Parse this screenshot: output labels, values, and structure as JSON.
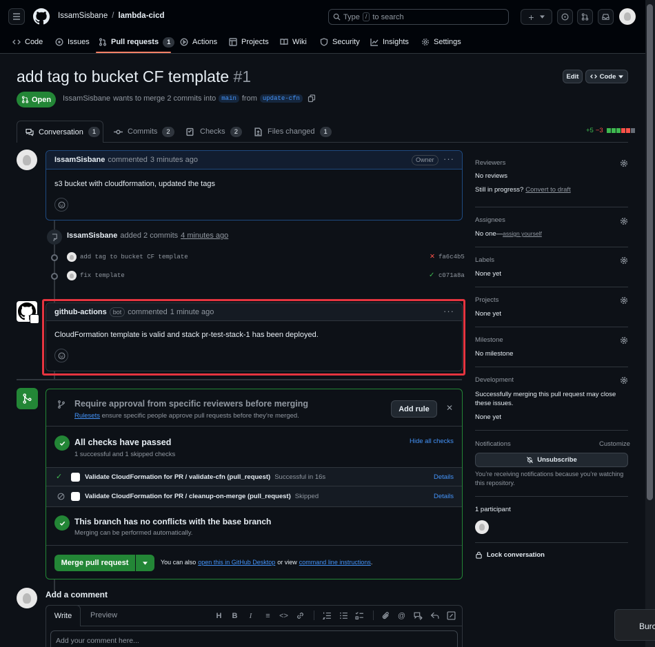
{
  "header": {
    "owner": "IssamSisbane",
    "separator": "/",
    "repo": "lambda-cicd",
    "search_placeholder_a": "Type",
    "search_key": "/",
    "search_placeholder_b": "to search",
    "new_button": "+"
  },
  "repo_tabs": [
    {
      "label": "Code"
    },
    {
      "label": "Issues"
    },
    {
      "label": "Pull requests",
      "count": "1"
    },
    {
      "label": "Actions"
    },
    {
      "label": "Projects"
    },
    {
      "label": "Wiki"
    },
    {
      "label": "Security"
    },
    {
      "label": "Insights"
    },
    {
      "label": "Settings"
    }
  ],
  "pr": {
    "title": "add tag to bucket CF template",
    "number": "#1",
    "edit_label": "Edit",
    "code_label": "Code",
    "state": "Open",
    "author": "IssamSisbane",
    "summary_mid": "wants to merge 2 commits into",
    "base_branch": "main",
    "from_word": "from",
    "head_branch": "update-cfn",
    "tabs": [
      {
        "label": "Conversation",
        "count": "1"
      },
      {
        "label": "Commits",
        "count": "2"
      },
      {
        "label": "Checks",
        "count": "2"
      },
      {
        "label": "Files changed",
        "count": "1"
      }
    ],
    "additions": "+5",
    "deletions": "−3"
  },
  "timeline": {
    "comment1": {
      "author": "IssamSisbane",
      "action": "commented",
      "time": "3 minutes ago",
      "badge": "Owner",
      "body": "s3 bucket with cloudformation, updated the tags"
    },
    "commits_event": {
      "author": "IssamSisbane",
      "action": "added 2 commits",
      "time": "4 minutes ago",
      "commits": [
        {
          "message": "add tag to bucket CF template",
          "sha": "fa6c4b5",
          "status": "✕"
        },
        {
          "message": "fix template",
          "sha": "c071a8a",
          "status": "✓"
        }
      ]
    },
    "comment2": {
      "author": "github-actions",
      "badge": "bot",
      "action": "commented",
      "time": "1 minute ago",
      "body": "CloudFormation template is valid and stack pr-test-stack-1 has been deployed."
    }
  },
  "merge_box": {
    "approval_title": "Require approval from specific reviewers before merging",
    "rulesets_link": "Rulesets",
    "approval_desc": "ensure specific people approve pull requests before they’re merged.",
    "add_rule": "Add rule",
    "checks_title": "All checks have passed",
    "checks_sub": "1 successful and 1 skipped checks",
    "hide_checks": "Hide all checks",
    "checks": [
      {
        "name": "Validate CloudFormation for PR / validate-cfn (pull_request)",
        "status": "Successful in 16s",
        "details": "Details"
      },
      {
        "name": "Validate CloudFormation for PR / cleanup-on-merge (pull_request)",
        "status": "Skipped",
        "details": "Details"
      }
    ],
    "conflicts_title": "This branch has no conflicts with the base branch",
    "conflicts_sub": "Merging can be performed automatically.",
    "merge_button": "Merge pull request",
    "also_text": "You can also",
    "desktop_link": "open this in GitHub Desktop",
    "or_view": "or view",
    "cli_link": "command line instructions",
    "period": "."
  },
  "comment_form": {
    "heading": "Add a comment",
    "write_tab": "Write",
    "preview_tab": "Preview",
    "placeholder": "Add your comment here..."
  },
  "sidebar": {
    "reviewers_label": "Reviewers",
    "reviewers_value": "No reviews",
    "in_progress": "Still in progress?",
    "convert_draft": "Convert to draft",
    "assignees_label": "Assignees",
    "assignees_value": "No one—",
    "assign_yourself": "assign yourself",
    "labels_label": "Labels",
    "labels_value": "None yet",
    "projects_label": "Projects",
    "projects_value": "None yet",
    "milestone_label": "Milestone",
    "milestone_value": "No milestone",
    "development_label": "Development",
    "development_desc": "Successfully merging this pull request may close these issues.",
    "development_value": "None yet",
    "notifications_label": "Notifications",
    "customize": "Customize",
    "unsubscribe": "Unsubscribe",
    "notif_desc": "You’re receiving notifications because you’re watching this repository.",
    "participants": "1 participant",
    "lock": "Lock conversation"
  },
  "toast": {
    "text": "Burc"
  },
  "colors": {
    "accent": "#4493f8",
    "success": "#238636",
    "danger": "#f85149",
    "highlight_border": "#e5343f"
  }
}
